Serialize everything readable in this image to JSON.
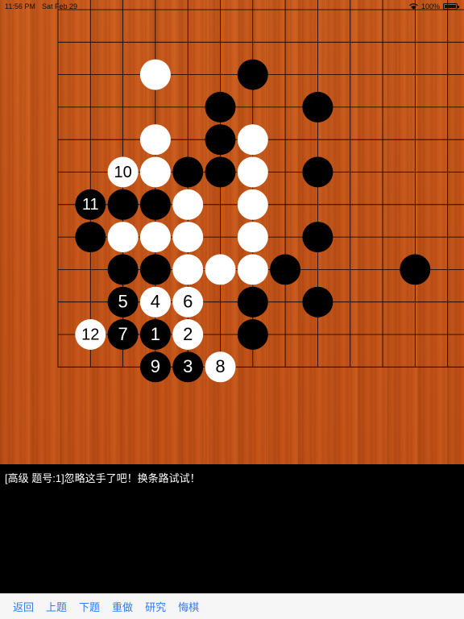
{
  "status_bar": {
    "time": "11:56 PM",
    "date": "Sat Feb 29",
    "battery": "100%"
  },
  "board": {
    "colors": {
      "wood": "#c45418",
      "line": "#000000",
      "black": "#000000",
      "white": "#ffffff"
    },
    "stones": [
      {
        "c": "W",
        "col": 3,
        "row": 2
      },
      {
        "c": "B",
        "col": 6,
        "row": 2
      },
      {
        "c": "B",
        "col": 5,
        "row": 3
      },
      {
        "c": "B",
        "col": 8,
        "row": 3
      },
      {
        "c": "W",
        "col": 3,
        "row": 4
      },
      {
        "c": "B",
        "col": 5,
        "row": 4
      },
      {
        "c": "W",
        "col": 6,
        "row": 4
      },
      {
        "c": "W",
        "col": 2,
        "row": 5,
        "n": "10"
      },
      {
        "c": "W",
        "col": 3,
        "row": 5
      },
      {
        "c": "B",
        "col": 4,
        "row": 5
      },
      {
        "c": "B",
        "col": 5,
        "row": 5
      },
      {
        "c": "W",
        "col": 6,
        "row": 5
      },
      {
        "c": "B",
        "col": 8,
        "row": 5
      },
      {
        "c": "B",
        "col": 1,
        "row": 6,
        "n": "11"
      },
      {
        "c": "B",
        "col": 2,
        "row": 6
      },
      {
        "c": "B",
        "col": 3,
        "row": 6
      },
      {
        "c": "W",
        "col": 4,
        "row": 6
      },
      {
        "c": "W",
        "col": 6,
        "row": 6
      },
      {
        "c": "B",
        "col": 1,
        "row": 7
      },
      {
        "c": "W",
        "col": 2,
        "row": 7
      },
      {
        "c": "W",
        "col": 3,
        "row": 7
      },
      {
        "c": "W",
        "col": 4,
        "row": 7
      },
      {
        "c": "W",
        "col": 6,
        "row": 7
      },
      {
        "c": "B",
        "col": 8,
        "row": 7
      },
      {
        "c": "B",
        "col": 2,
        "row": 8
      },
      {
        "c": "B",
        "col": 3,
        "row": 8
      },
      {
        "c": "W",
        "col": 4,
        "row": 8
      },
      {
        "c": "W",
        "col": 5,
        "row": 8
      },
      {
        "c": "W",
        "col": 6,
        "row": 8
      },
      {
        "c": "B",
        "col": 7,
        "row": 8
      },
      {
        "c": "B",
        "col": 11,
        "row": 8
      },
      {
        "c": "B",
        "col": 2,
        "row": 9,
        "n": "5"
      },
      {
        "c": "W",
        "col": 3,
        "row": 9,
        "n": "4"
      },
      {
        "c": "W",
        "col": 4,
        "row": 9,
        "n": "6"
      },
      {
        "c": "B",
        "col": 6,
        "row": 9
      },
      {
        "c": "B",
        "col": 8,
        "row": 9
      },
      {
        "c": "W",
        "col": 1,
        "row": 10,
        "n": "12"
      },
      {
        "c": "B",
        "col": 2,
        "row": 10,
        "n": "7"
      },
      {
        "c": "B",
        "col": 3,
        "row": 10,
        "n": "1"
      },
      {
        "c": "W",
        "col": 4,
        "row": 10,
        "n": "2"
      },
      {
        "c": "B",
        "col": 6,
        "row": 10
      },
      {
        "c": "B",
        "col": 3,
        "row": 11,
        "n": "9"
      },
      {
        "c": "B",
        "col": 4,
        "row": 11,
        "n": "3"
      },
      {
        "c": "W",
        "col": 5,
        "row": 11,
        "n": "8"
      }
    ]
  },
  "message": "[高级 题号:1]忽略这手了吧！换条路试试！",
  "toolbar": {
    "back": "返回",
    "prev": "上题",
    "next": "下题",
    "redo": "重做",
    "study": "研究",
    "undo": "悔棋"
  }
}
